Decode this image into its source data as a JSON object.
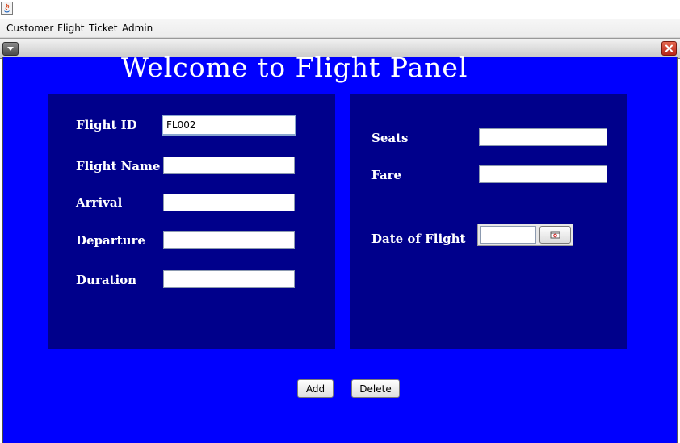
{
  "window": {
    "icon": "java-app-icon"
  },
  "menu": [
    {
      "label": "Customer"
    },
    {
      "label": "Flight"
    },
    {
      "label": "Ticket"
    },
    {
      "label": "Admin"
    }
  ],
  "frame": {
    "system_icon": "dropdown-menu-icon",
    "close_icon": "close-icon"
  },
  "main": {
    "title": "Welcome to Flight Panel",
    "left_panel": {
      "flight_id": {
        "label": "Flight ID",
        "value": "FL002"
      },
      "flight_name": {
        "label": "Flight Name",
        "value": ""
      },
      "arrival": {
        "label": "Arrival",
        "value": ""
      },
      "departure": {
        "label": "Departure",
        "value": ""
      },
      "duration": {
        "label": "Duration",
        "value": ""
      }
    },
    "right_panel": {
      "seats": {
        "label": "Seats",
        "value": ""
      },
      "fare": {
        "label": "Fare",
        "value": ""
      },
      "date_of_flight": {
        "label": "Date of Flight",
        "value": "",
        "icon": "calendar-icon"
      }
    },
    "buttons": {
      "add": "Add",
      "delete": "Delete"
    }
  },
  "colors": {
    "background": "#0000ff",
    "panel": "#00008b",
    "text": "#ffffff"
  }
}
